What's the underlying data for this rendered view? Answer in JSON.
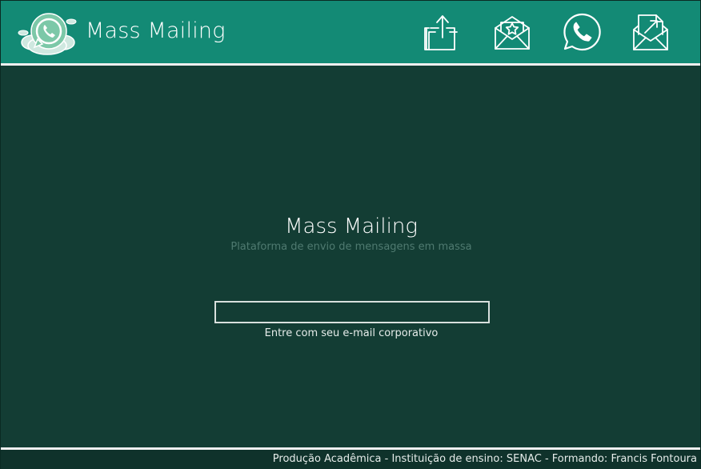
{
  "header": {
    "brand": "Mass Mailing",
    "nav": [
      {
        "icon": "upload-icon"
      },
      {
        "icon": "starred-mail-icon"
      },
      {
        "icon": "whatsapp-icon"
      },
      {
        "icon": "send-mail-icon"
      }
    ]
  },
  "main": {
    "title": "Mass Mailing",
    "subtitle": "Plataforma de envio de mensagens em massa",
    "email_value": "",
    "email_label": "Entre com seu e-mail corporativo"
  },
  "footer": {
    "text": "Produção Acadêmica - Instituição de ensino: SENAC - Formando: Francis Fontoura"
  },
  "colors": {
    "header_bg": "#138a75",
    "body_bg": "#133d34",
    "accent": "#ffffff"
  }
}
